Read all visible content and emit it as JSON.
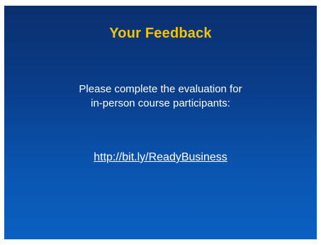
{
  "slide": {
    "title": "Your Feedback",
    "message_lines": [
      "Please complete the evaluation for",
      "in-person course participants:"
    ],
    "link_text": "http://bit.ly/ReadyBusiness",
    "colors": {
      "title": "#f5c400",
      "text": "#ffffff",
      "background_top": "#0b2f6e",
      "background_bottom": "#0a60c2"
    }
  }
}
